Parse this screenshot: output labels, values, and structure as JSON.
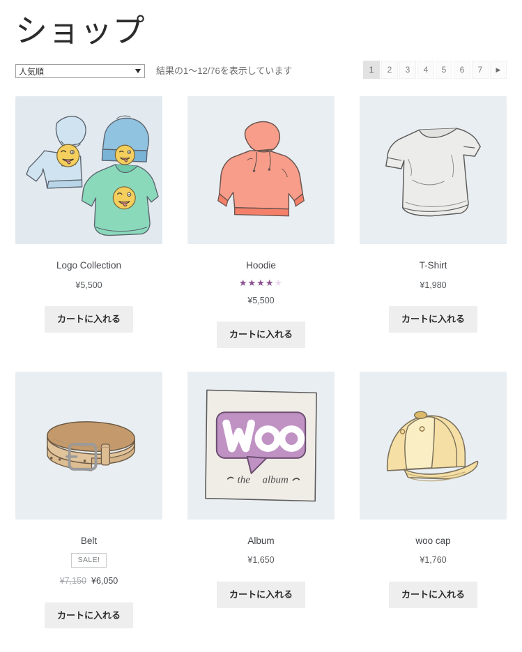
{
  "page": {
    "title": "ショップ"
  },
  "toolbar": {
    "orderby": {
      "selected_label": "人気順",
      "options": [
        "人気順"
      ],
      "arrow_icon": "chevron-down-icon"
    },
    "result_count": "結果の1〜12/76を表示しています"
  },
  "pagination": {
    "pages": [
      "1",
      "2",
      "3",
      "4",
      "5",
      "6",
      "7"
    ],
    "current": "1",
    "next_label": "▶"
  },
  "labels": {
    "add_to_cart": "カートに入れる",
    "sale": "SALE!"
  },
  "colors": {
    "thumb_bg": "#e3eaef",
    "button_bg": "#eeeeee",
    "star": "#8b4f8f",
    "star_off": "#ead7ec",
    "pagination_active_bg": "#e2e2e2"
  },
  "products": [
    {
      "name": "Logo Collection",
      "image": "logo-collection-image",
      "price": "¥5,500",
      "rating": null,
      "on_sale": false,
      "add_to_cart": "カートに入れる"
    },
    {
      "name": "Hoodie",
      "image": "hoodie-image",
      "price": "¥5,500",
      "rating": {
        "stars": "★★★★",
        "stars_off": "★",
        "value": 4,
        "max": 5
      },
      "on_sale": false,
      "add_to_cart": "カートに入れる"
    },
    {
      "name": "T-Shirt",
      "image": "t-shirt-image",
      "price": "¥1,980",
      "rating": null,
      "on_sale": false,
      "add_to_cart": "カートに入れる"
    },
    {
      "name": "Belt",
      "image": "belt-image",
      "price_regular": "¥7,150",
      "price_sale": "¥6,050",
      "rating": null,
      "on_sale": true,
      "sale_label": "SALE!",
      "add_to_cart": "カートに入れる"
    },
    {
      "name": "Album",
      "image": "album-image",
      "price": "¥1,650",
      "rating": null,
      "on_sale": false,
      "add_to_cart": "カートに入れる"
    },
    {
      "name": "woo cap",
      "image": "woo-cap-image",
      "price": "¥1,760",
      "rating": null,
      "on_sale": false,
      "add_to_cart": "カートに入れる"
    }
  ]
}
